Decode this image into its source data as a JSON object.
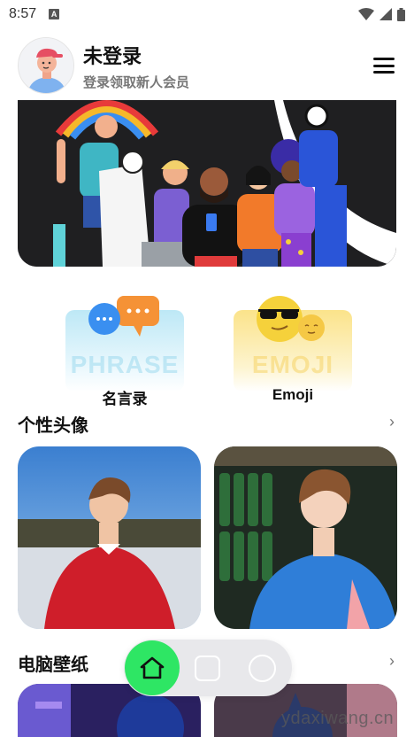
{
  "status_bar": {
    "time": "8:57",
    "notification_badge": "A"
  },
  "header": {
    "user_name": "未登录",
    "user_subtitle": "登录领取新人会员"
  },
  "features": [
    {
      "label": "名言录",
      "watermark": "PHRASE",
      "icon": "speech-bubbles-icon"
    },
    {
      "label": "Emoji",
      "watermark": "EMOJI",
      "icon": "emoji-faces-icon"
    }
  ],
  "sections": [
    {
      "title": "个性头像",
      "arrow": "›"
    },
    {
      "title": "电脑壁纸",
      "arrow": "›"
    }
  ],
  "bottom_nav": {
    "items": [
      "home-icon",
      "square-icon",
      "circle-icon"
    ]
  },
  "watermark": "ydaxiwang.cn",
  "colors": {
    "accent_green": "#2ee664",
    "banner_bg": "#1f1f21",
    "phrase_bg": "#bde8f6",
    "emoji_bg": "#fbe38a"
  }
}
